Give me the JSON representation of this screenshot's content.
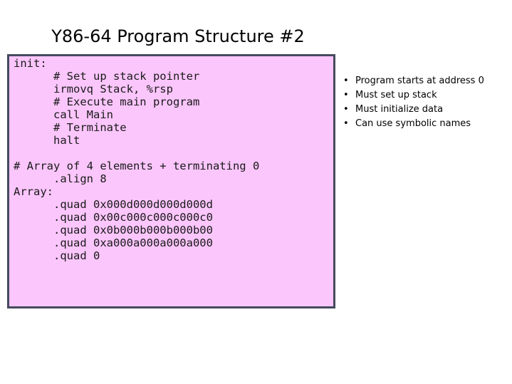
{
  "slide": {
    "title": "Y86-64 Program Structure #2",
    "code_box": {
      "background_color": "#fbc6fc",
      "border_color": "#454a5e",
      "text_color": "#1a1a1a",
      "code": "init:\n      # Set up stack pointer\n      irmovq Stack, %rsp\n      # Execute main program\n      call Main\n      # Terminate\n      halt\n\n# Array of 4 elements + terminating 0\n      .align 8\nArray:\n      .quad 0x000d000d000d000d\n      .quad 0x00c000c000c000c0\n      .quad 0x0b000b000b000b00\n      .quad 0xa000a000a000a000\n      .quad 0"
    },
    "bullets": {
      "marker": "•",
      "items": [
        "Program starts at address 0",
        "Must set up stack",
        "Must initialize data",
        "Can use symbolic names"
      ]
    }
  }
}
